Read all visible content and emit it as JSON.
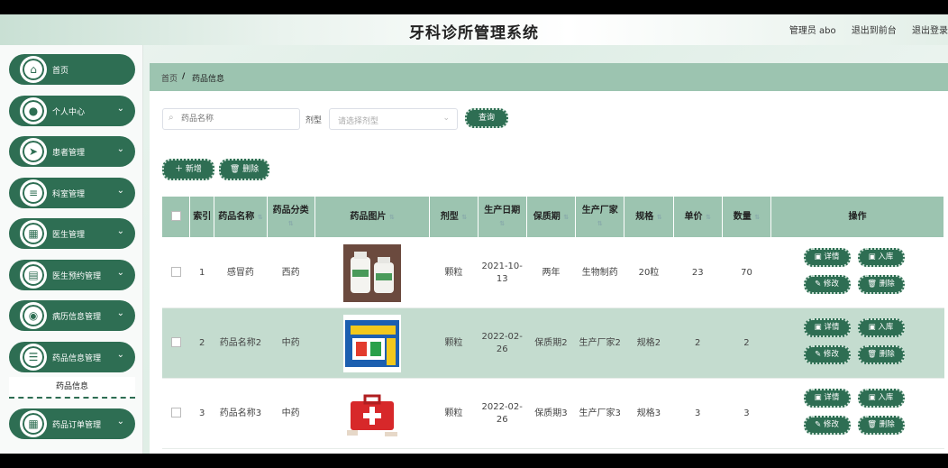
{
  "header": {
    "title": "牙科诊所管理系统",
    "user": "管理员 abo",
    "link_front": "退出到前台",
    "link_logout": "退出登录"
  },
  "sidebar": {
    "items": [
      {
        "label": "首页",
        "icon": "home-icon",
        "glyph": "⌂",
        "has_chevron": false
      },
      {
        "label": "个人中心",
        "icon": "user-icon",
        "glyph": "●",
        "has_chevron": true
      },
      {
        "label": "患者管理",
        "icon": "send-icon",
        "glyph": "➤",
        "has_chevron": true
      },
      {
        "label": "科室管理",
        "icon": "sliders-icon",
        "glyph": "≡",
        "has_chevron": true
      },
      {
        "label": "医生管理",
        "icon": "grid-icon",
        "glyph": "▦",
        "has_chevron": true
      },
      {
        "label": "医生预约管理",
        "icon": "clipboard-icon",
        "glyph": "▤",
        "has_chevron": true
      },
      {
        "label": "病历信息管理",
        "icon": "location-icon",
        "glyph": "◉",
        "has_chevron": true
      },
      {
        "label": "药品信息管理",
        "icon": "list-icon",
        "glyph": "☰",
        "has_chevron": true
      },
      {
        "label": "药品订单管理",
        "icon": "grid-icon",
        "glyph": "▦",
        "has_chevron": true
      }
    ],
    "submenu_active": "药品信息"
  },
  "breadcrumb": {
    "home": "首页",
    "separator": "/",
    "current": "药品信息"
  },
  "filters": {
    "name_placeholder": "药品名称",
    "type_label": "剂型",
    "type_placeholder": "请选择剂型",
    "query_button": "查询"
  },
  "actions": {
    "add": "＋ 新增",
    "delete": "🗑 删除"
  },
  "table": {
    "columns": [
      "索引",
      "药品名称",
      "药品分类",
      "药品图片",
      "剂型",
      "生产日期",
      "保质期",
      "生产厂家",
      "规格",
      "单价",
      "数量",
      "操作"
    ],
    "rows": [
      {
        "index": "1",
        "name": "感冒药",
        "category": "西药",
        "image": "white-bottles",
        "form": "颗粒",
        "date": "2021-10-13",
        "shelf": "两年",
        "maker": "生物制药",
        "spec": "20粒",
        "price": "23",
        "qty": "70"
      },
      {
        "index": "2",
        "name": "药品名称2",
        "category": "中药",
        "image": "blue-yellow-box",
        "form": "颗粒",
        "date": "2022-02-26",
        "shelf": "保质期2",
        "maker": "生产厂家2",
        "spec": "规格2",
        "price": "2",
        "qty": "2"
      },
      {
        "index": "3",
        "name": "药品名称3",
        "category": "中药",
        "image": "red-first-aid-box",
        "form": "颗粒",
        "date": "2022-02-26",
        "shelf": "保质期3",
        "maker": "生产厂家3",
        "spec": "规格3",
        "price": "3",
        "qty": "3"
      }
    ],
    "op_labels": {
      "detail": "▣ 详情",
      "stock_in": "▣ 入库",
      "edit": "✎ 修改",
      "delete": "🗑 删除"
    }
  },
  "colors": {
    "accent": "#2e6e53",
    "header_bg": "#9cc4b0",
    "alt_row": "#c4dccf"
  }
}
